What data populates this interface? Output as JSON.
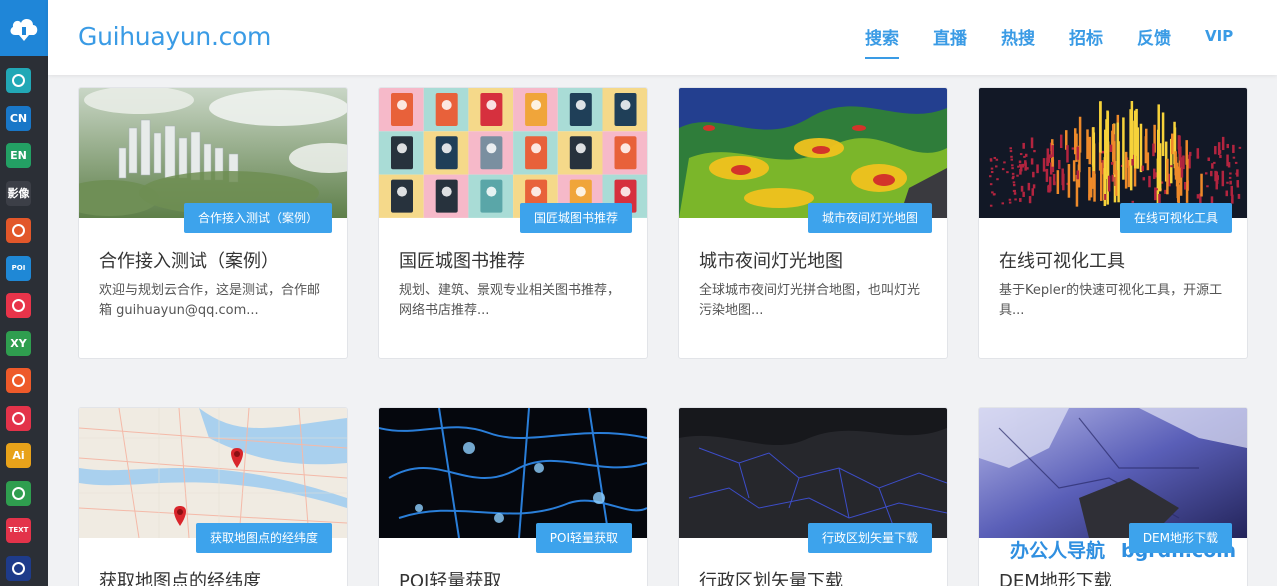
{
  "site": {
    "brand": "Guihuayun.com"
  },
  "nav": [
    {
      "label": "搜索",
      "active": true
    },
    {
      "label": "直播"
    },
    {
      "label": "热搜"
    },
    {
      "label": "招标"
    },
    {
      "label": "反馈"
    },
    {
      "label": "VIP"
    }
  ],
  "rail": [
    {
      "icon": "search-map-icon",
      "text": "",
      "color": "#22a8b6"
    },
    {
      "icon": "map-cn-icon",
      "text": "CN",
      "color": "#1977c8"
    },
    {
      "icon": "map-en-icon",
      "text": "EN",
      "color": "#23a064"
    },
    {
      "icon": "map-image-icon",
      "text": "影像",
      "color": "#3c3f47"
    },
    {
      "icon": "china-map-icon",
      "text": "",
      "color": "#e2572a"
    },
    {
      "icon": "poi-icon",
      "text": "POI",
      "color": "#1f88d6"
    },
    {
      "icon": "pie-chart-icon",
      "text": "",
      "color": "#e8344a"
    },
    {
      "icon": "xy-icon",
      "text": "XY",
      "color": "#2f9e4f"
    },
    {
      "icon": "lightbulb-icon",
      "text": "",
      "color": "#ee5a2a"
    },
    {
      "icon": "image-icon",
      "text": "",
      "color": "#e3334a"
    },
    {
      "icon": "ai-icon",
      "text": "Ai",
      "color": "#e8a21a"
    },
    {
      "icon": "road-icon",
      "text": "",
      "color": "#2f9e4f"
    },
    {
      "icon": "text-icon",
      "text": "TEXT",
      "color": "#e3334a"
    },
    {
      "icon": "palette-icon",
      "text": "",
      "color": "#1e3b8a"
    }
  ],
  "cards": [
    {
      "tag": "合作接入测试（案例）",
      "title": "合作接入测试（案例）",
      "desc": "欢迎与规划云合作，这是测试，合作邮箱 guihuayun@qq.com..."
    },
    {
      "tag": "国匠城图书推荐",
      "title": "国匠城图书推荐",
      "desc": "规划、建筑、景观专业相关图书推荐，网络书店推荐..."
    },
    {
      "tag": "城市夜间灯光地图",
      "title": "城市夜间灯光地图",
      "desc": "全球城市夜间灯光拼合地图，也叫灯光污染地图..."
    },
    {
      "tag": "在线可视化工具",
      "title": "在线可视化工具",
      "desc": "基于Kepler的快速可视化工具，开源工具..."
    },
    {
      "tag": "获取地图点的经纬度",
      "title": "获取地图点的经纬度",
      "desc": ""
    },
    {
      "tag": "POI轻量获取",
      "title": "POI轻量获取",
      "desc": ""
    },
    {
      "tag": "行政区划矢量下载",
      "title": "行政区划矢量下载",
      "desc": ""
    },
    {
      "tag": "DEM地形下载",
      "title": "DEM地形下载",
      "desc": ""
    }
  ],
  "watermark": {
    "part1": "办公人导航",
    "part2": "bgrdh.com"
  }
}
